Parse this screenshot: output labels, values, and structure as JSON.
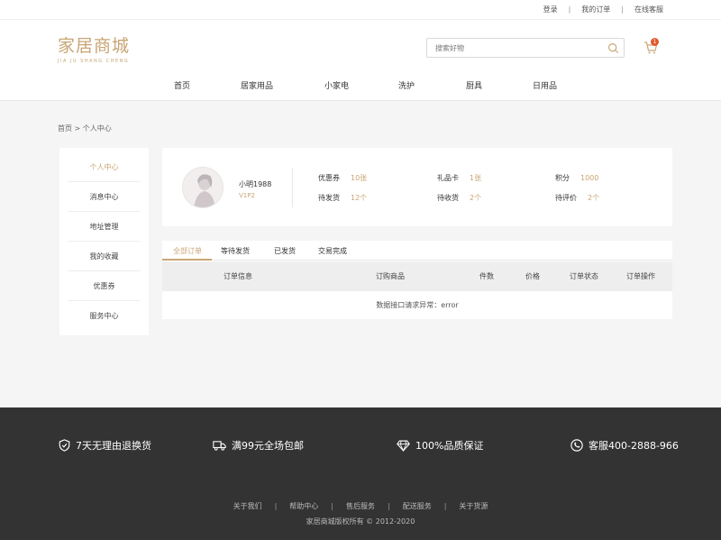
{
  "topbar": {
    "login": "登录",
    "my_orders": "我的订单",
    "customer_service": "在线客服"
  },
  "logo": {
    "name": "家居商城",
    "subtitle": "JIA JU SHANG CHENG"
  },
  "search": {
    "placeholder": "搜索好物"
  },
  "cart": {
    "count": "1"
  },
  "nav": [
    "首页",
    "居家用品",
    "小家电",
    "洗护",
    "厨具",
    "日用品"
  ],
  "breadcrumb": "首页 > 个人中心",
  "sidebar": [
    {
      "label": "个人中心",
      "active": true
    },
    {
      "label": "消息中心"
    },
    {
      "label": "地址管理"
    },
    {
      "label": "我的收藏"
    },
    {
      "label": "优惠券"
    },
    {
      "label": "服务中心"
    }
  ],
  "profile": {
    "username": "小明1988",
    "level": "V1P2",
    "stats": [
      {
        "label": "优惠券",
        "value": "10张"
      },
      {
        "label": "礼品卡",
        "value": "1张"
      },
      {
        "label": "积分",
        "value": "1000"
      },
      {
        "label": "待发货",
        "value": "12个"
      },
      {
        "label": "待收货",
        "value": "2个"
      },
      {
        "label": "待评价",
        "value": "2个"
      }
    ]
  },
  "orders": {
    "tabs": [
      "全部订单",
      "等待发货",
      "已发货",
      "交易完成"
    ],
    "columns": [
      "订单信息",
      "订购商品",
      "件数",
      "价格",
      "订单状态",
      "订单操作"
    ],
    "empty_message": "数据接口请求异常：error"
  },
  "footer": {
    "features": [
      "7天无理由退换货",
      "满99元全场包邮",
      "100%品质保证",
      "客服400-2888-966"
    ],
    "links": [
      "关于我们",
      "帮助中心",
      "售后服务",
      "配送服务",
      "关于货源"
    ],
    "copyright": "家居商城版权所有 © 2012-2020"
  },
  "colors": {
    "accent": "#c8a574",
    "footer_bg": "#333333",
    "main_bg": "#f5f5f5"
  }
}
